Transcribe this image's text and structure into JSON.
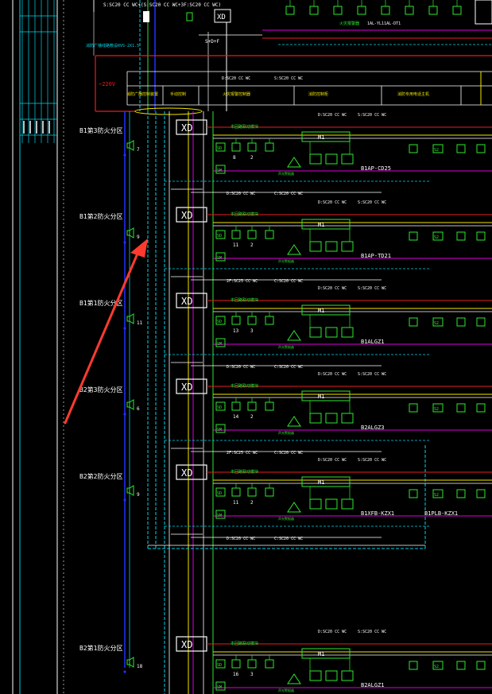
{
  "colors": {
    "background": "#000000",
    "white": "#ffffff",
    "cyan": "#00d4e8",
    "green": "#2ee82e",
    "yellow": "#f2e600",
    "magenta": "#e000e0",
    "red": "#e61e1e",
    "blue": "#2030ff",
    "arrow": "#ff3b2f"
  },
  "top": {
    "cable_spec": "S:SC20 CC WC+(S:SC20 CC WC+3F:SC20 CC WC)",
    "xd_label": "XD",
    "sd_label": "S+D+F",
    "cyan_note": "消防广播线路敷设RVS-2X1.5",
    "right_headers": [
      "1AL-YL11AL-DT1",
      "XD"
    ],
    "right_green_label": "火灾报警器"
  },
  "header_bar": {
    "voltage": "~220V",
    "col1": "消防广播控制装置",
    "col2": "手动控制",
    "col3": "火灾报警控制器",
    "col4": "消防控制柜",
    "col5": "消防专用电话主机",
    "wire_label": "D:SC20 CC WC",
    "wire_label2": "S:SC20 CC WC"
  },
  "zones": [
    {
      "name": "B1第3防火分区",
      "speaker_no": "7",
      "xd": "XD",
      "module": "M1",
      "num_a": "8",
      "num_b": "2",
      "tag": "B1AP-CD25",
      "bus": "本回路联动模块"
    },
    {
      "name": "B1第2防火分区",
      "speaker_no": "9",
      "xd": "XD",
      "module": "M1",
      "num_a": "11",
      "num_b": "2",
      "tag": "B1AP-TD21",
      "bus": "本回路联动模块"
    },
    {
      "name": "B1第1防火分区",
      "speaker_no": "11",
      "xd": "XD",
      "module": "M1",
      "num_a": "13",
      "num_b": "3",
      "tag": "B1ALGZ1",
      "bus": "本回路联动模块"
    },
    {
      "name": "B2第3防火分区",
      "speaker_no": "6",
      "xd": "XD",
      "module": "M1",
      "num_a": "14",
      "num_b": "2",
      "tag": "B2ALGZ3",
      "bus": "本回路联动模块"
    },
    {
      "name": "B2第2防火分区",
      "speaker_no": "9",
      "xd": "XD",
      "module": "M1",
      "num_a": "11",
      "num_b": "2",
      "tag": "B1XFB-KZX1",
      "tag2": "B1PLB-KZX1",
      "bus": "本回路联动模块"
    },
    {
      "name": "B2第1防火分区",
      "speaker_no": "18",
      "xd": "XD",
      "module": "M1",
      "num_a": "16",
      "num_b": "3",
      "tag": "B2ALGZ1",
      "bus": "本回路联动模块"
    }
  ],
  "wire_labels": {
    "w1": "2F:SC25 CC WC",
    "w2": "1F:SC25 CC WC",
    "w3": "C:SC20 CC WC",
    "w4": "D:SC20 CC WC",
    "w5": "S:SC20 CC WC",
    "w6": "4F:SC25 CC WC",
    "w7": "3F:SC25 CC WC"
  },
  "small_labels": {
    "sd": "SD",
    "sm": "SM",
    "s2": "S2",
    "fire_alarm": "声光警报器",
    "plus": "x2"
  }
}
